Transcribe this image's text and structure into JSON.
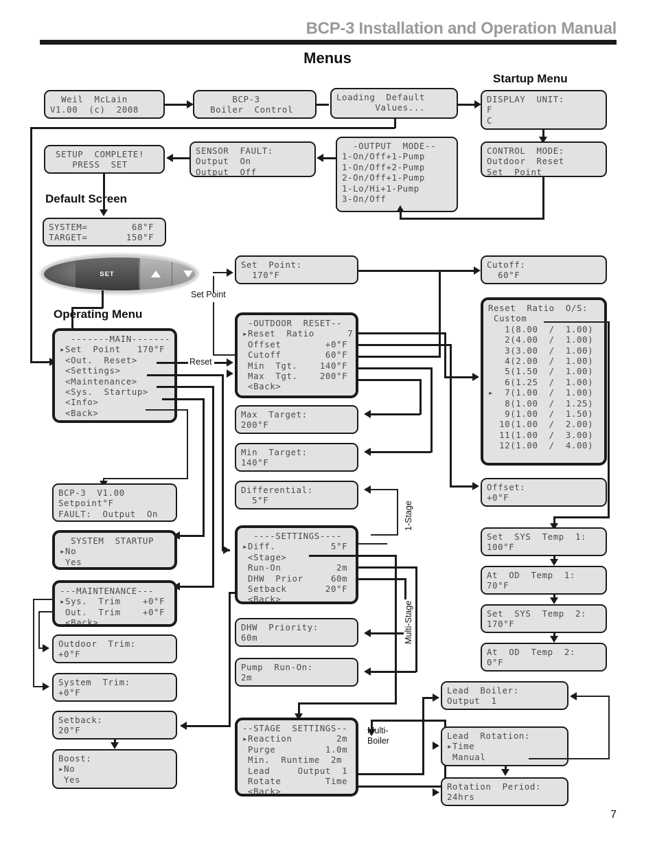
{
  "header": {
    "manual_title": "BCP-3 Installation and Operation Manual",
    "page_heading": "Menus",
    "page_number": "7"
  },
  "section_labels": {
    "startup_menu": "Startup Menu",
    "default_screen": "Default Screen",
    "operating_menu": "Operating Menu"
  },
  "connector_labels": {
    "set_point": "Set Point",
    "reset": "Reset",
    "one_stage": "1-Stage",
    "multi_stage": "Multi-Stage",
    "multi_boiler": "Multi-\nBoiler"
  },
  "keypad": {
    "set_label": "SET",
    "up_icon": "triangle-up-icon",
    "down_icon": "triangle-down-icon"
  },
  "screens": {
    "splash": "  Weil  McLain\nV1.00  (c)  2008",
    "boiler_control": "      BCP-3\n  Boiler  Control",
    "loading": "Loading  Default\n       Values...",
    "display_unit": "DISPLAY  UNIT:\nF\nC",
    "control_mode": "CONTROL  MODE:\nOutdoor  Reset\nSet  Point",
    "output_mode": "  -OUTPUT  MODE--\n1-On/Off+1-Pump\n1-On/Off+2-Pump\n2-On/Off+1-Pump\n1-Lo/Hi+1-Pump\n3-On/Off",
    "sensor_fault": "SENSOR  FAULT:\nOutput  On\nOutput  Off",
    "setup_complete": " SETUP  COMPLETE!\n    PRESS  SET",
    "default_screen": "SYSTEM=        68°F\nTARGET=       150°F",
    "set_point": "Set  Point:\n  170°F",
    "cutoff": "Cutoff:\n  60°F",
    "main_menu": "  -------MAIN-------\n▸Set  Point   170°F\n <Out.  Reset>\n <Settings>\n <Maintenance>\n <Sys.  Startup>\n <Info>\n <Back>",
    "outdoor_reset": " -OUTDOOR  RESET--\n▸Reset  Ratio      7\n Offset        +0°F\n Cutoff        60°F\n Min  Tgt.    140°F\n Max  Tgt.    200°F\n <Back>",
    "reset_ratio": "Reset  Ratio  O/S:\n Custom\n   1(8.00  /  1.00)\n   2(4.00  /  1.00)\n   3(3.00  /  1.00)\n   4(2.00  /  1.00)\n   5(1.50  /  1.00)\n   6(1.25  /  1.00)\n▸  7(1.00  /  1.00)\n   8(1.00  /  1.25)\n   9(1.00  /  1.50)\n  10(1.00  /  2.00)\n  11(1.00  /  3.00)\n  12(1.00  /  4.00)",
    "max_target": "Max  Target:\n200°F",
    "min_target": "Min  Target:\n140°F",
    "differential": "Differential:\n  5°F",
    "offset": "Offset:\n+0°F",
    "set_sys_temp_1": "Set  SYS  Temp  1:\n100°F",
    "at_od_temp_1": "At  OD  Temp  1:\n70°F",
    "set_sys_temp_2": "Set  SYS  Temp  2:\n170°F",
    "at_od_temp_2": "At  OD  Temp  2:\n0°F",
    "info": "BCP-3  V1.00\nSetpoint°F\nFAULT:  Output  On",
    "system_startup": "  SYSTEM  STARTUP\n▸No\n Yes",
    "maintenance": "---MAINTENANCE---\n▸Sys.  Trim    +0°F\n Out.  Trim    +0°F\n <Back>",
    "outdoor_trim": "Outdoor  Trim:\n+0°F",
    "system_trim": "System  Trim:\n+0°F",
    "setback": "Setback:\n20°F",
    "boost": "Boost:\n▸No\n Yes",
    "settings": "  ----SETTINGS----\n▸Diff.          5°F\n <Stage>\n Run-On          2m\n DHW  Prior     60m\n Setback       20°F\n <Back>",
    "dhw_priority": "DHW  Priority:\n60m",
    "pump_run_on": "Pump  Run-On:\n2m",
    "stage_settings": "--STAGE  SETTINGS--\n▸Reaction        2m\n Purge         1.0m\n Min.  Runtime  2m\n Lead     Output  1\n Rotate        Time\n <Back>",
    "lead_boiler": "Lead  Boiler:\nOutput  1",
    "lead_rotation": "Lead  Rotation:\n▸Time\n Manual",
    "rotation_period": "Rotation  Period:\n24hrs"
  }
}
